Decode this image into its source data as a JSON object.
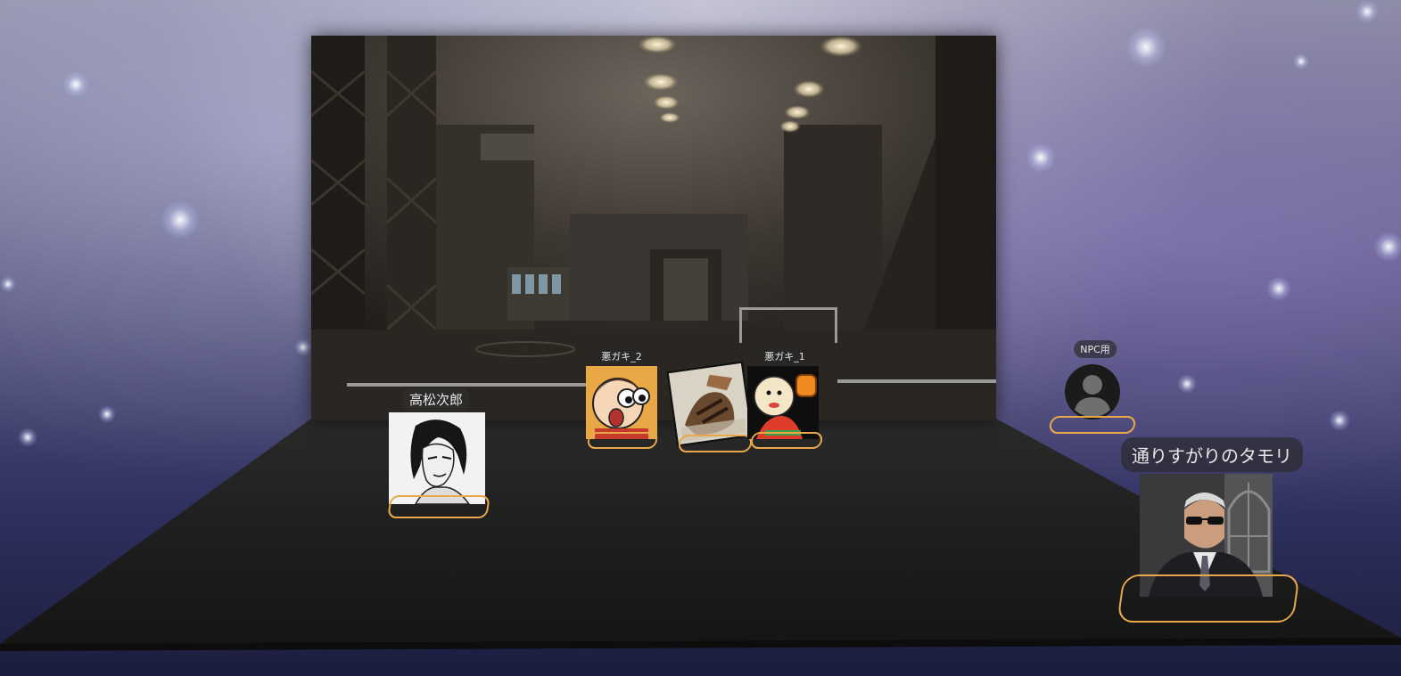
{
  "scene": {
    "background": "space-nebula",
    "backdrop_image": "industrial-tunnel",
    "floor_color": "#1e1e1e",
    "ring_color": "#e9a84a"
  },
  "characters": [
    {
      "id": "takamatsu",
      "name": "高松次郎",
      "portrait": "manga-man-portrait"
    },
    {
      "id": "warugaki2",
      "name": "悪ガキ_2",
      "portrait": "cartoon-boy-portrait"
    },
    {
      "id": "card",
      "name": "",
      "portrait": "illustration-card"
    },
    {
      "id": "warugaki1",
      "name": "悪ガキ_1",
      "portrait": "cartoon-kid-drum-portrait"
    },
    {
      "id": "npc",
      "name": "NPC用",
      "portrait": "default-user-icon"
    },
    {
      "id": "tamori",
      "name": "通りすがりのタモリ",
      "portrait": "man-sunglasses-suit-portrait"
    }
  ]
}
